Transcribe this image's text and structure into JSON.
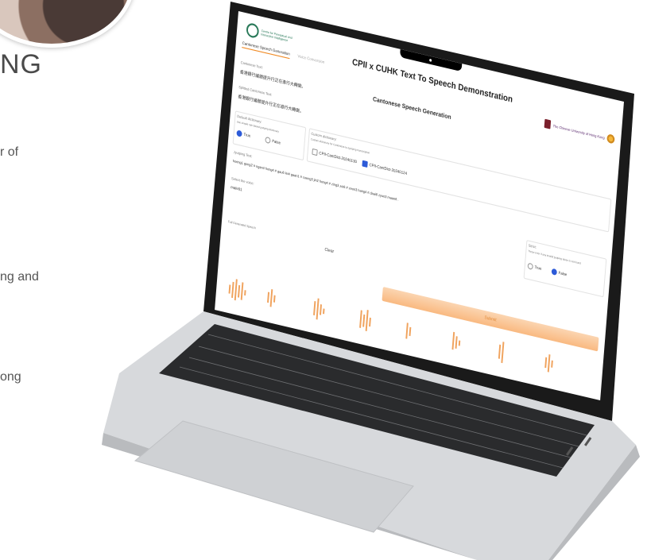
{
  "left": {
    "heading": "NG",
    "line1": "r of",
    "line2": "ng and",
    "line3": "ong"
  },
  "app": {
    "org_logo_text": "Centre for Perceptual and Interactive Intelligence",
    "title": "CPII x CUHK Text To Speech Demonstration",
    "tabs": [
      {
        "label": "Cantonese Speech Generation",
        "active": true
      },
      {
        "label": "Voice Conversion",
        "active": false
      }
    ],
    "university": "The Chinese University of Hong Kong",
    "panel_title": "Cantonese Speech Generation",
    "cantonese_text": {
      "label": "Cantonese Text:",
      "value": "香港銀行議題提升行正在進行大轉變。"
    },
    "split_text": {
      "label": "Splitted Cantonese Text:",
      "value": "香港銀行議題提升行正在進行大轉變。"
    },
    "default_dictionary": {
      "label": "Default dictionary:",
      "hint": "Use simple rule-based jyutping dictionary",
      "options": [
        {
          "label": "True",
          "selected": true
        },
        {
          "label": "False",
          "selected": false
        }
      ]
    },
    "custom_dictionary": {
      "label": "Custom dictionary:",
      "hint": "Custom dictionary for Cantonese-to-Jyutping transcription",
      "options": [
        {
          "label": "CPII-CantDict-20240130",
          "checked": false
        },
        {
          "label": "CPII-CantDict-20240124",
          "checked": true
        }
      ]
    },
    "jyutping": {
      "label": "Jyutping Text:",
      "value": "hoeng1 gong2 # ngan4 hong4 # gau6 lei4 gaan1 # coeng3 jin2 hong4 # zing3 zoi6 # zeon3 hang4 # daai6 zyun3 maan6 ."
    },
    "strict": {
      "label": "Strict:",
      "hint": "Throw error if any invalid jyutping token is not found",
      "options": [
        {
          "label": "True",
          "selected": false
        },
        {
          "label": "False",
          "selected": true
        }
      ]
    },
    "voice": {
      "label": "Select the voice:",
      "value": "male01"
    },
    "generated_label": "Full Generated Speech",
    "clear_label": "Clear",
    "submit_label": "Submit",
    "colors": {
      "accent": "#f08a24",
      "select": "#2d5bd8",
      "submit": "#f9b980"
    }
  }
}
